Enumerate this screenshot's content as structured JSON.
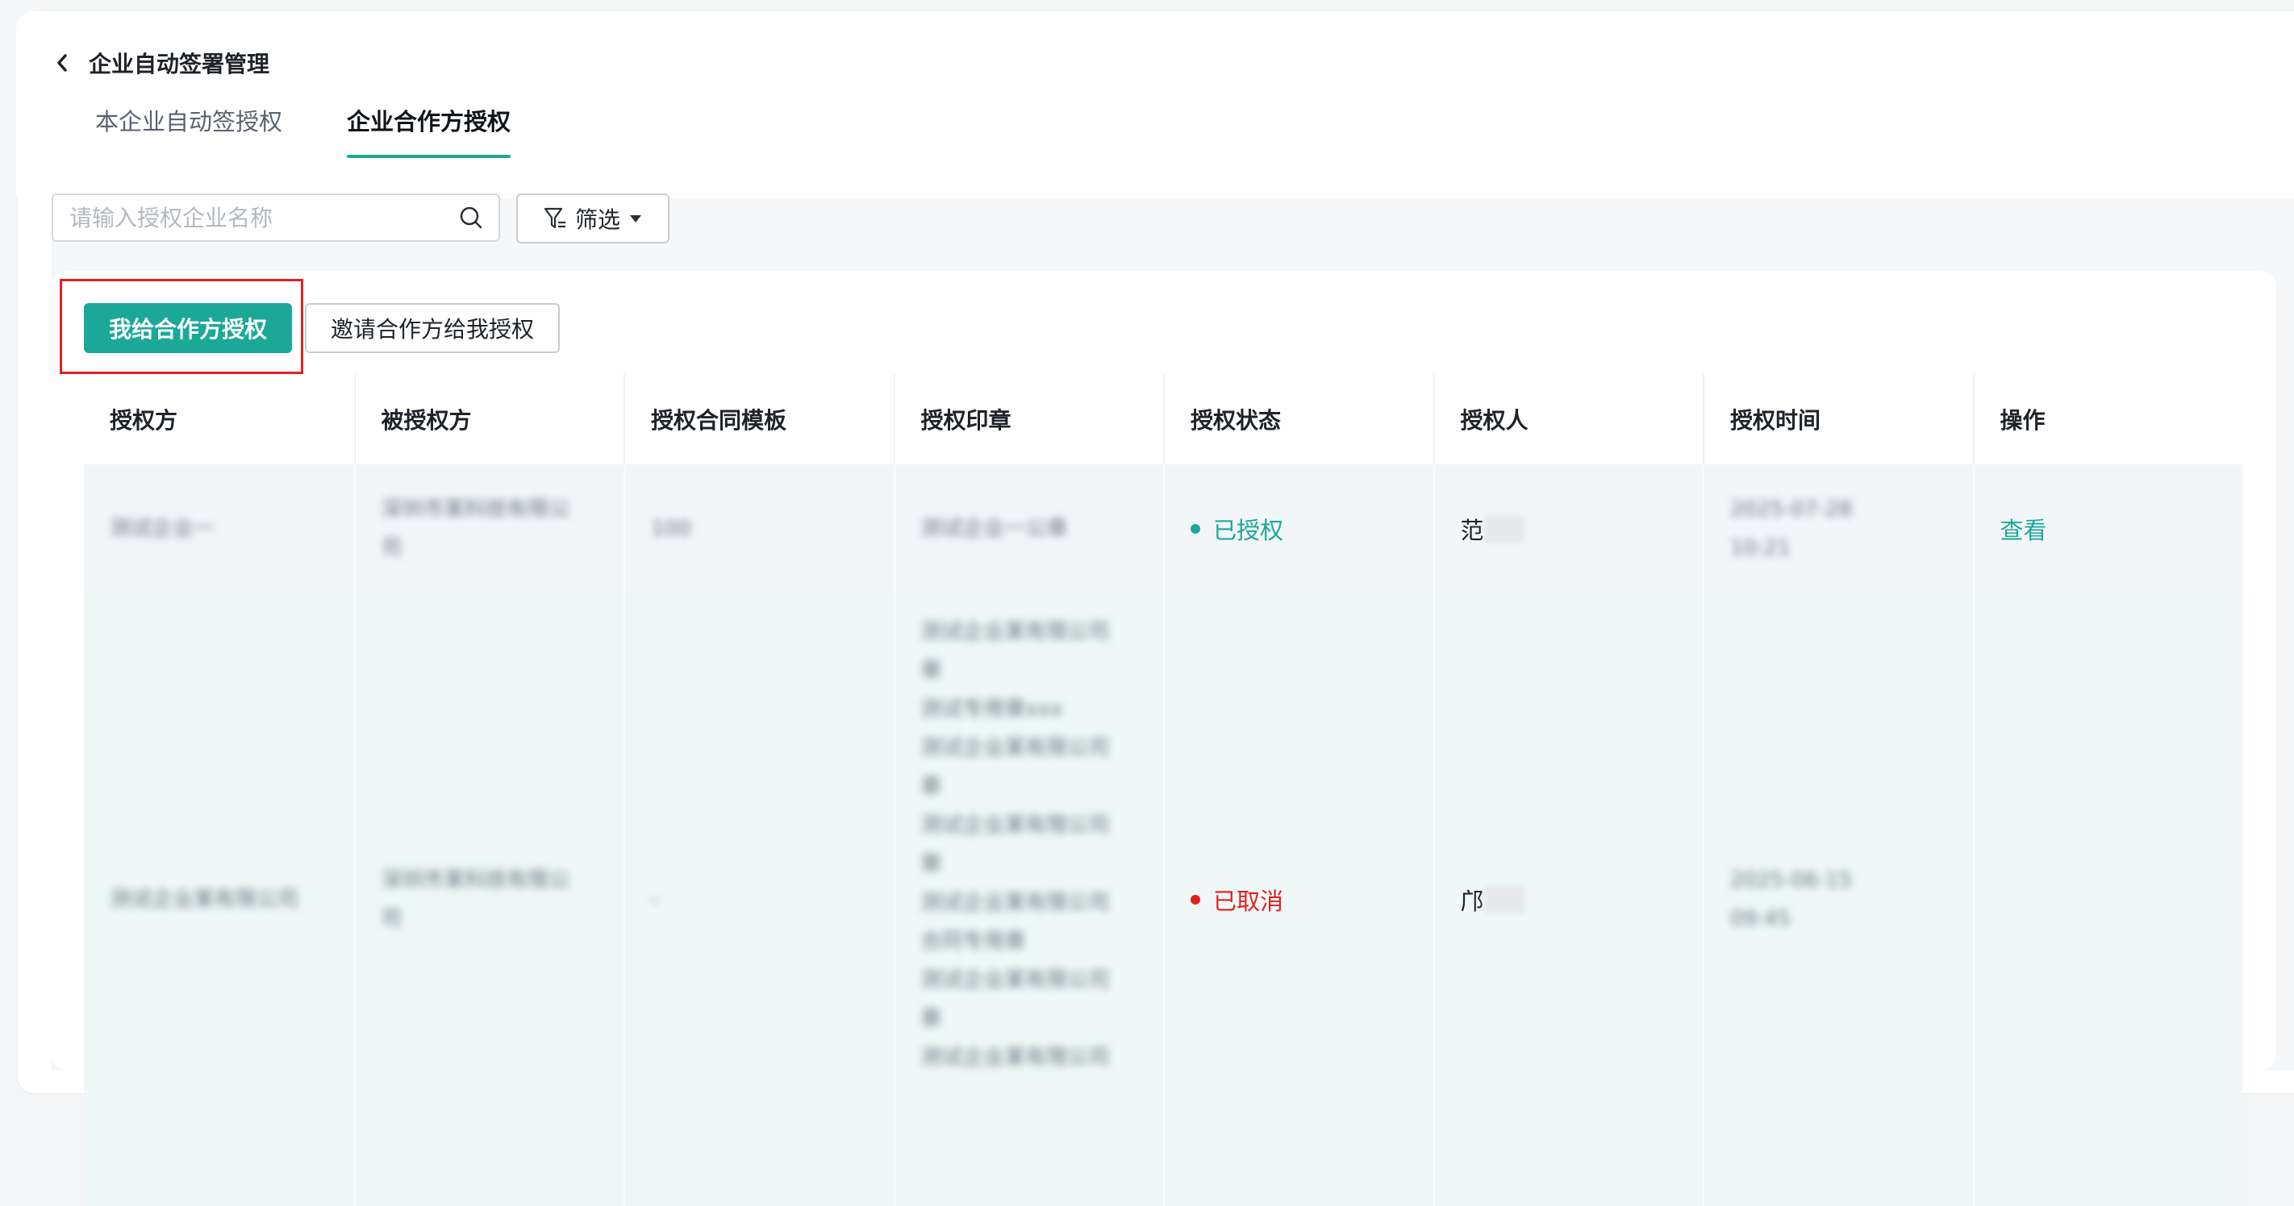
{
  "header": {
    "back_icon": "chevron-left-icon",
    "title": "企业自动签署管理",
    "tabs": [
      {
        "label": "本企业自动签授权",
        "active": false
      },
      {
        "label": "企业合作方授权",
        "active": true
      }
    ]
  },
  "toolbar": {
    "search_placeholder": "请输入授权企业名称",
    "search_icon": "search-icon",
    "filter_label": "筛选",
    "filter_icon": "filter-icon"
  },
  "actions": {
    "primary_label": "我给合作方授权",
    "secondary_label": "邀请合作方给我授权"
  },
  "table": {
    "columns": [
      "授权方",
      "被授权方",
      "授权合同模板",
      "授权印章",
      "授权状态",
      "授权人",
      "授权时间",
      "操作"
    ],
    "rows": [
      {
        "grantor": "测试企业一",
        "grantee": "深圳市某科技有限公司",
        "template": "100",
        "seal": "测试企业一公章",
        "status": "已授权",
        "person": "范",
        "person_mask": "某某",
        "time_line1": "2025-07-28",
        "time_line2": "10:21",
        "action": "查看"
      },
      {
        "grantor": "测试企业某有限公司",
        "grantee": "深圳市某科技有限公司",
        "template": "-",
        "seal_lines": [
          "测试企业某有限公司",
          "章",
          "测试专用章xxx",
          "测试企业某有限公司",
          "章",
          "测试企业某有限公司",
          "章",
          "测试企业某有限公司",
          "合同专用章",
          "测试企业某有限公司",
          "章",
          "测试企业某有限公司"
        ],
        "status": "已取消",
        "person": "邝",
        "person_mask": "某某",
        "time_line1": "2025-06-15",
        "time_line2": "09:45",
        "action": ""
      }
    ]
  },
  "colors": {
    "accent": "#1ba899",
    "danger": "#e02020"
  }
}
